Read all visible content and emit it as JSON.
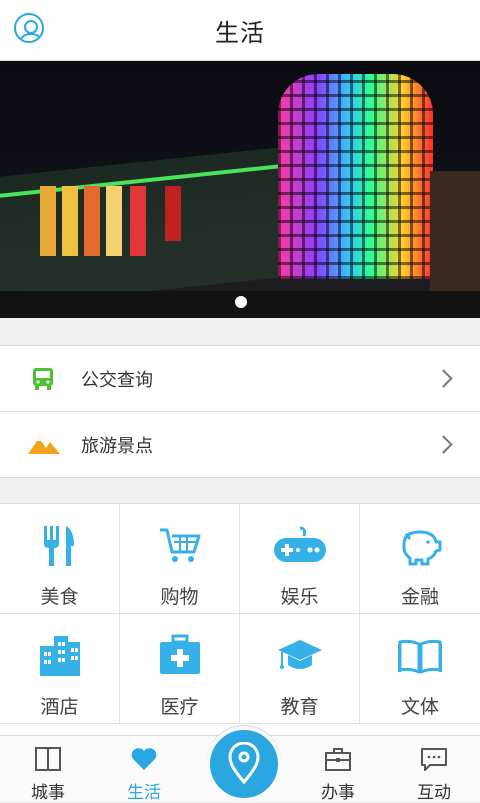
{
  "header": {
    "title": "生活",
    "avatar_icon": "user-avatar-icon"
  },
  "banner": {
    "indicator_count": 1,
    "active_index": 0
  },
  "list": [
    {
      "label": "公交查询",
      "icon": "bus-icon",
      "color": "#4cc232"
    },
    {
      "label": "旅游景点",
      "icon": "mountain-icon",
      "color": "#f2a21b"
    }
  ],
  "grid": [
    {
      "label": "美食",
      "icon": "fork-knife-icon"
    },
    {
      "label": "购物",
      "icon": "shopping-cart-icon"
    },
    {
      "label": "娱乐",
      "icon": "gamepad-icon"
    },
    {
      "label": "金融",
      "icon": "piggy-bank-icon"
    },
    {
      "label": "酒店",
      "icon": "building-icon"
    },
    {
      "label": "医疗",
      "icon": "medical-kit-icon"
    },
    {
      "label": "教育",
      "icon": "graduation-cap-icon"
    },
    {
      "label": "文体",
      "icon": "book-icon"
    }
  ],
  "tabbar": {
    "tabs": [
      {
        "label": "城事",
        "icon": "book-outline-icon",
        "active": false
      },
      {
        "label": "生活",
        "icon": "heart-icon",
        "active": true
      },
      {
        "label": "办事",
        "icon": "briefcase-icon",
        "active": false
      },
      {
        "label": "互动",
        "icon": "chat-icon",
        "active": false
      }
    ],
    "center_icon": "location-pin-icon"
  },
  "colors": {
    "accent": "#2aa6e0",
    "icon_blue": "#35b1e8"
  }
}
